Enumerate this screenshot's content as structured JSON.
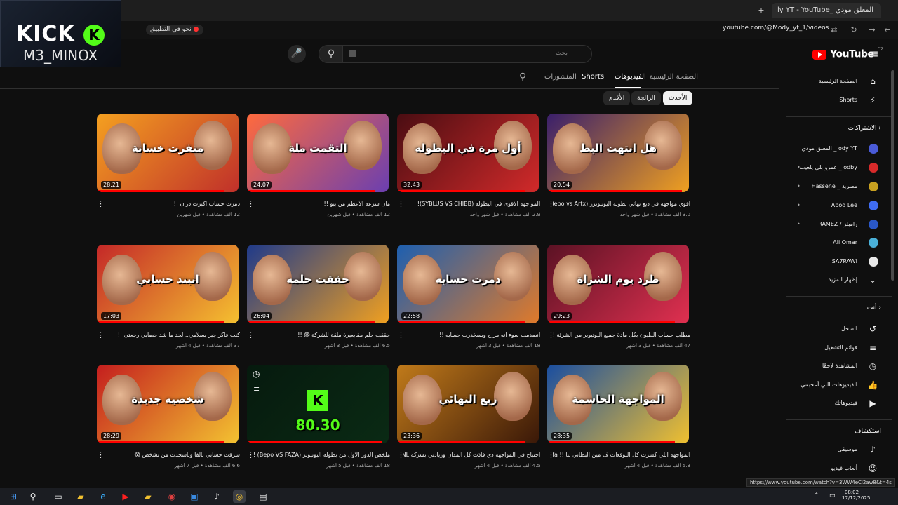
{
  "browser": {
    "tab_title": "ly YT - YouTube_ المعلق مودي",
    "new_tab": "+",
    "url": "youtube.com/@Mody_yt_1/videos",
    "bookmark": "نحو في التطبيق",
    "status_url": "https://www.youtube.com/watch?v=3WW4eCl2aw8&t=4s"
  },
  "overlay": {
    "brand": "KICK",
    "brand_icon": "K",
    "username": "M3_MINOX"
  },
  "topbar": {
    "search_placeholder": "بحث",
    "logo_text": "YouTube",
    "logo_cc": "DZ"
  },
  "channel_tabs": [
    {
      "label": "الصفحة الرئيسية"
    },
    {
      "label": "الفيديوهات"
    },
    {
      "label": "Shorts"
    },
    {
      "label": "المنشورات"
    }
  ],
  "chips": [
    {
      "label": "الأحدث"
    },
    {
      "label": "الرائجة"
    },
    {
      "label": "الأقدم"
    }
  ],
  "videos": [
    {
      "title": "اقوي مواجهة في دبع نهائي بطولة اليوتيوبرز (Bepo vs Artx) !!",
      "meta": "3.0 ألف مشاهدة • قبل شهر واحد",
      "duration": "20:54",
      "thumb_text": "هل انتهت البط",
      "colors": [
        "#3a1f6b",
        "#f0a020"
      ],
      "progress": 0.95
    },
    {
      "title": "المواجهة الأقوى في البطولة (SYBLUS VS CHIBB)!",
      "meta": "2.9 ألف مشاهدة • قبل شهر واحد",
      "duration": "32:43",
      "thumb_text": "أول مرة في البطوله",
      "colors": [
        "#4a0d12",
        "#d12a2a"
      ],
      "progress": 0.9
    },
    {
      "title": "مان سرعة الاعظم من يبو !!",
      "meta": "12 ألف مشاهدة • قبل شهرين",
      "duration": "24:07",
      "thumb_text": "التقمت ملة",
      "colors": [
        "#ff6a3d",
        "#6b3fb0"
      ],
      "progress": 0.9
    },
    {
      "title": "دمرت حساب اكبرت دران !!",
      "meta": "12 ألف مشاهدة • قبل شهرين",
      "duration": "28:21",
      "thumb_text": "منفرت خسانة",
      "colors": [
        "#f4a020",
        "#c0302a"
      ],
      "progress": 0.9
    },
    {
      "title": "مطلب حساب الطيون بكل مادة جميع اليوتيوبر من الشرئة !!",
      "meta": "47 ألف مشاهدة • قبل 3 أشهر",
      "duration": "29:23",
      "thumb_text": "طرد يوم الشراة",
      "colors": [
        "#5b1224",
        "#e03050"
      ],
      "progress": 0.9
    },
    {
      "title": "انصدمت سوء انه مزاح ويسخدرت حسابه !!",
      "meta": "18 ألف مشاهدة • قبل 3 أشهر",
      "duration": "22:58",
      "thumb_text": "دمرت حسابه",
      "colors": [
        "#1d5fb0",
        "#e07a2a"
      ],
      "progress": 0.9
    },
    {
      "title": "حققت حلم مقايعيرة ملقة للشركة 😱 !!",
      "meta": "6.5 ألف مشاهدة • قبل 3 أشهر",
      "duration": "26:04",
      "thumb_text": "حققت حلمه",
      "colors": [
        "#1f3a8a",
        "#f0a020"
      ],
      "progress": 0.9
    },
    {
      "title": "كنت فاكر جير بسلامي.. لحد ما شد حصابي رجعتي !!",
      "meta": "37 ألف مشاهدة • قبل 4 أشهر",
      "duration": "17:03",
      "thumb_text": "انبند حسابي",
      "colors": [
        "#c42828",
        "#f5c030"
      ],
      "progress": 0.9
    },
    {
      "title": "المواجهة اللي كسرت كل التوقعات ف مين البطاني بنا !! VS Jafa",
      "meta": "5.3 ألف مشاهدة • قبل 4 أشهر",
      "duration": "28:35",
      "thumb_text": "المواجهة الحاسمة",
      "colors": [
        "#1a4ea0",
        "#f0c030"
      ],
      "progress": 0.9
    },
    {
      "title": "اجتياح في المواجهة دي فاذت كل المدان وزيادني بشركة BNL !",
      "meta": "4.5 ألف مشاهدة • قبل 4 أشهر",
      "duration": "23:36",
      "thumb_text": "ربع النهائي",
      "colors": [
        "#c07a1a",
        "#3a1808"
      ],
      "progress": 0.9
    },
    {
      "title": "ملخص الدور الأول من بطولة اليوتيوبر (Bepo VS FAZA) !!",
      "meta": "18 ألف مشاهدة • قبل 5 أشهر",
      "duration": "",
      "thumb_text": "80.30",
      "colors": [
        "#061a0e",
        "#0a2a14"
      ],
      "progress": 0.95
    },
    {
      "title": "سرقت حسابي بالفا وتاسحدت من تشخص 😱",
      "meta": "6.6 ألف مشاهدة • قبل 7 أشهر",
      "duration": "28:29",
      "thumb_text": "شخصيه جديدة",
      "colors": [
        "#c41e1e",
        "#f3c231"
      ],
      "progress": 0.9
    }
  ],
  "sidebar": {
    "main": [
      {
        "label": "الصفحة الرئيسية",
        "icon": "home-icon",
        "glyph": "⌂"
      },
      {
        "label": "Shorts",
        "icon": "shorts-icon",
        "glyph": "⚡"
      }
    ],
    "subs_heading": "الاشتراكات",
    "subs": [
      {
        "label": "المعلق مودي _ ody YT",
        "color": "#4a5bd8"
      },
      {
        "label": "عمرو بلي يلعيب _ odby",
        "color": "#d82a2a"
      },
      {
        "label": "Hassene _ مصرية",
        "color": "#c8a020"
      },
      {
        "label": "Abod Lee",
        "color": "#3f6cf0"
      },
      {
        "label": "RAMEZ / رامبلز",
        "color": "#2a58c8"
      },
      {
        "label": "Ali Omar",
        "color": "#4ab0d8"
      },
      {
        "label": "SA7RAWI",
        "color": "#e8e8e8"
      },
      {
        "label": "إظهار المزيد",
        "color": ""
      }
    ],
    "you_heading": "أنت",
    "you": [
      {
        "label": "السجل",
        "glyph": "↺"
      },
      {
        "label": "قوائم التشغيل",
        "glyph": "≡"
      },
      {
        "label": "المشاهدة لاحقًا",
        "glyph": "◷"
      },
      {
        "label": "الفيديوهات التي أعجبتني",
        "glyph": "👍"
      },
      {
        "label": "فيديوهاتك",
        "glyph": "▶"
      }
    ],
    "explore_heading": "استكشاف",
    "explore": [
      {
        "label": "موسيقى",
        "glyph": "♪"
      },
      {
        "label": "ألعاب فيديو",
        "glyph": "☺"
      }
    ]
  },
  "taskbar": {
    "time": "08:02",
    "date": "17/12/2025"
  }
}
